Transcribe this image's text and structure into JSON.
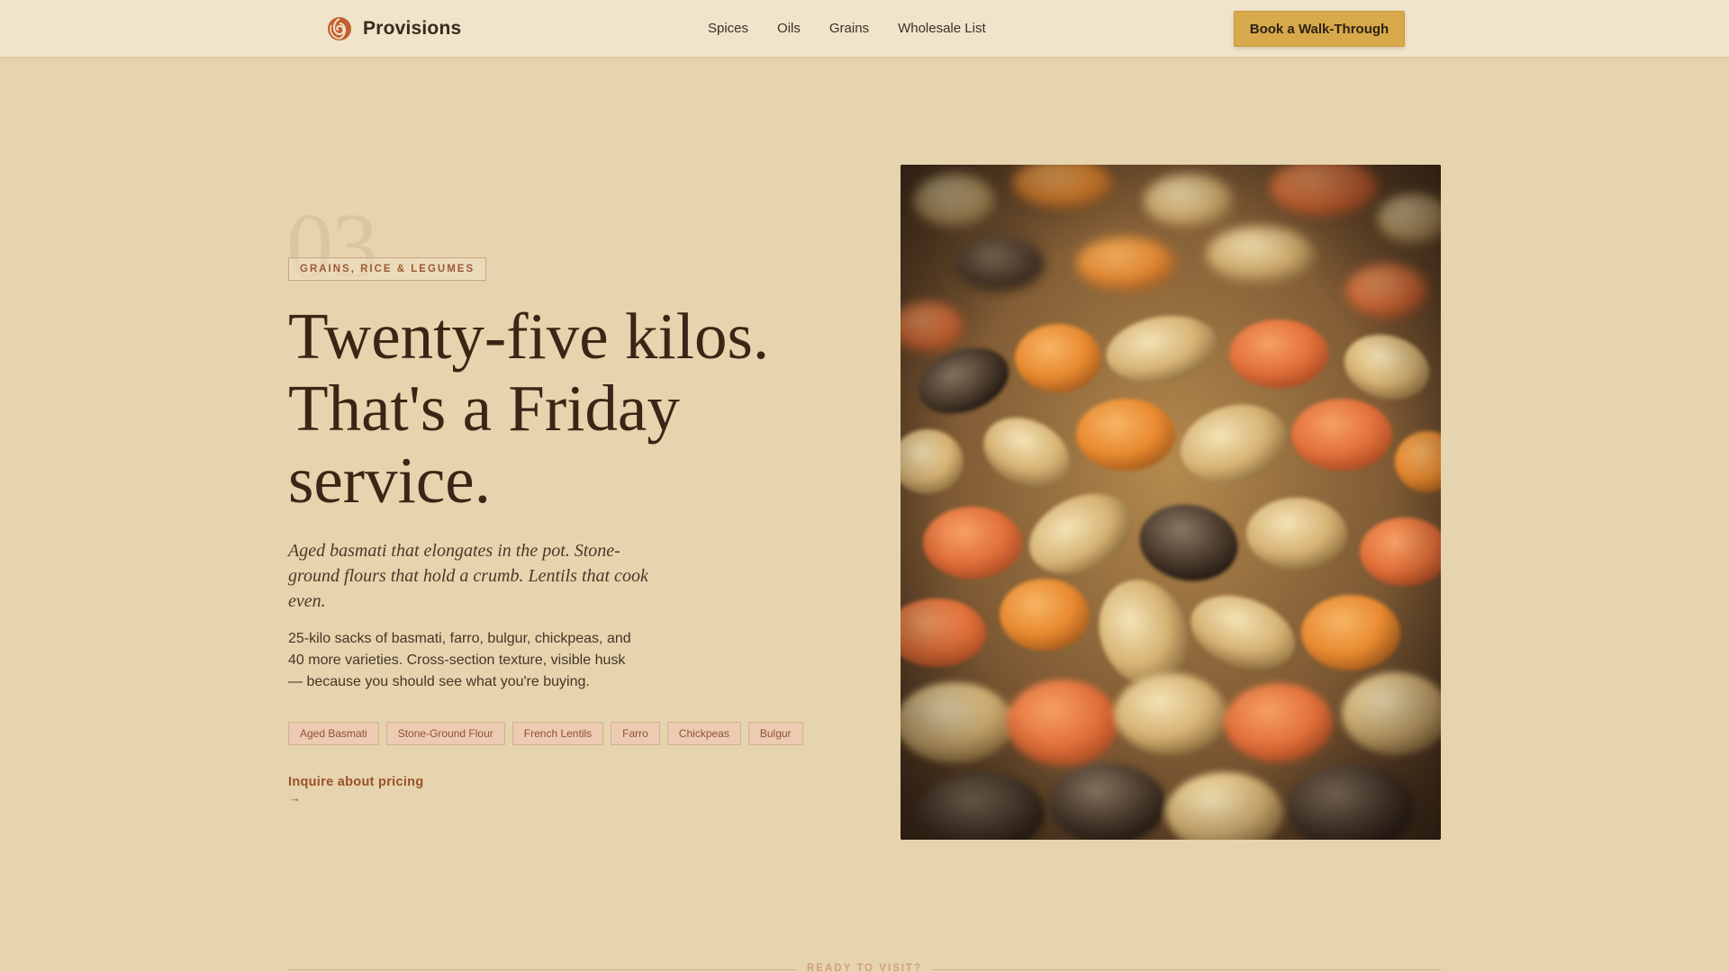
{
  "header": {
    "brand": "Provisions",
    "nav": [
      "Spices",
      "Oils",
      "Grains",
      "Wholesale List"
    ],
    "cta": "Book a Walk-Through"
  },
  "hero": {
    "number": "03",
    "category": "GRAINS, RICE & LEGUMES",
    "headline": [
      "Twenty-five kilos.",
      "That's a Friday",
      "service."
    ],
    "lede": "Aged basmati that elongates in the pot. Stone-ground flours that hold a crumb. Lentils that cook even.",
    "body": "25-kilo sacks of basmati, farro, bulgur, chickpeas, and 40 more varieties. Cross-section texture, visible husk — because you should see what you're buying.",
    "tags": [
      "Aged Basmati",
      "Stone-Ground Flour",
      "French Lentils",
      "Farro",
      "Chickpeas",
      "Bulgur"
    ],
    "inquire_label": "Inquire about pricing",
    "inquire_arrow": "→",
    "image_subject": "close-up of mixed grains, lentils and legumes"
  },
  "footer_strip": {
    "label": "READY TO VISIT?"
  },
  "colors": {
    "page_bg": "#e6d4ae",
    "header_bg": "#f0e4cb",
    "cta_bg": "#d7a94a",
    "accent": "#9a5228",
    "heading": "#3a2616"
  },
  "icons": {
    "brand_logo": "swirl-logo-icon",
    "inquire_arrow": "arrow-right-icon"
  }
}
